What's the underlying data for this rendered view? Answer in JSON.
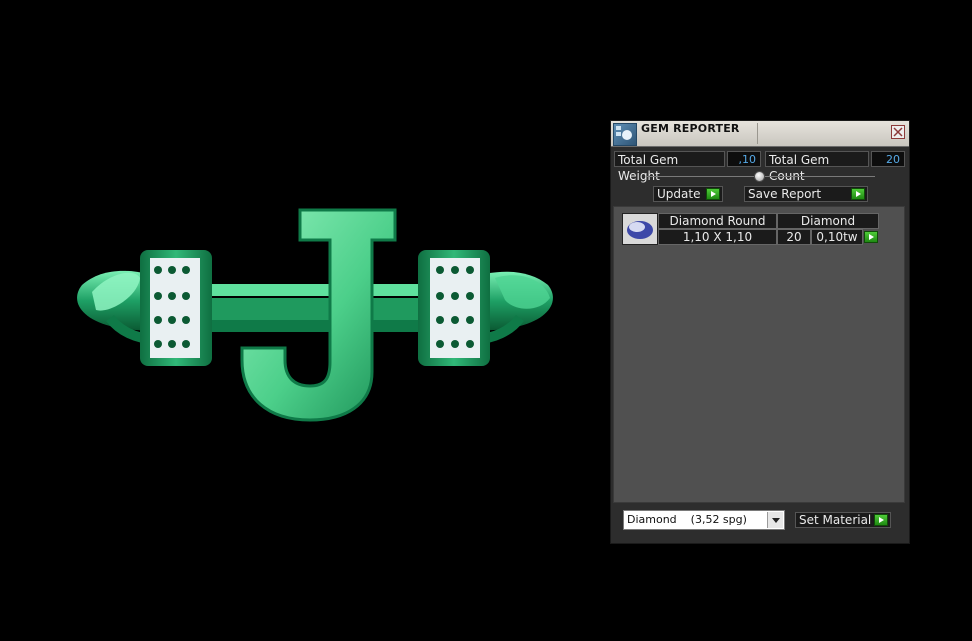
{
  "viewport": {
    "background": "#000000",
    "ring_colors": {
      "green_light": "#6fe6a8",
      "green_dark": "#0f7a48",
      "gem_white": "#e8eef2"
    }
  },
  "panel": {
    "title": "GEM REPORTER",
    "icons": {
      "app": "gem-reporter-icon",
      "close": "close-icon"
    },
    "total_weight_label": "Total Gem Weight",
    "total_weight_value": ",10",
    "total_count_label": "Total Gem Count",
    "total_count_value": "20",
    "update_label": "Update",
    "save_report_label": "Save Report",
    "gems": [
      {
        "name": "Diamond Round",
        "size": "1,10 X 1,10",
        "material": "Diamond",
        "count": "20",
        "weight": "0,10tw"
      }
    ],
    "material_select": "Diamond    (3,52 spg)",
    "set_material_label": "Set Material",
    "colors": {
      "accent_green": "#2fa81f",
      "value_blue": "#56a9e6",
      "panel_bg": "#2d2d2d",
      "list_bg": "#505050"
    }
  }
}
